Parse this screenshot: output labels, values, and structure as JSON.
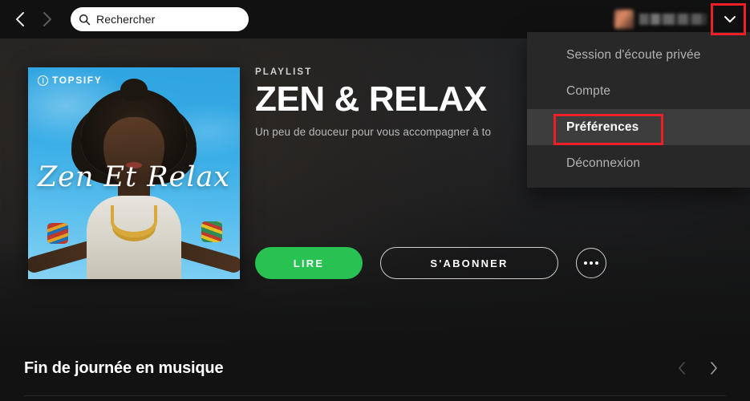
{
  "topbar": {
    "back_icon": "chevron-left-icon",
    "forward_icon": "chevron-right-icon",
    "search": {
      "icon": "search-icon",
      "value": "Rechercher",
      "placeholder": "Rechercher"
    },
    "user": {
      "avatar_alt": "user-avatar",
      "name_blurred": "",
      "chevron_icon": "chevron-down-icon"
    }
  },
  "dropdown": {
    "items": [
      {
        "label": "Session d'écoute privée",
        "highlighted": false
      },
      {
        "label": "Compte",
        "highlighted": false
      },
      {
        "label": "Préférences",
        "highlighted": true
      },
      {
        "label": "Déconnexion",
        "highlighted": false
      }
    ]
  },
  "playlist": {
    "kicker": "PLAYLIST",
    "title": "ZEN & RELAX",
    "description": "Un peu de douceur pour vous accompagner à to",
    "cover": {
      "brand_mark": "topsify-logo-icon",
      "brand_word": "TOPSIFY",
      "script_text": "Zen Et Relax"
    },
    "actions": {
      "play_label": "LIRE",
      "follow_label": "S'ABONNER",
      "more_icon": "more-options-icon"
    }
  },
  "section": {
    "title": "Fin de journée en musique",
    "prev_icon": "chevron-left-icon",
    "next_icon": "chevron-right-icon"
  },
  "annotations": {
    "color": "#ee1f26",
    "chevron_box": "highlight-profile-chevron",
    "preferences_box": "highlight-preferences-item"
  },
  "colors": {
    "accent_green": "#27c252",
    "page_bg": "#121212",
    "menu_bg": "#282828",
    "menu_highlight_bg": "#3d3d3d",
    "annotation_red": "#ee1f26"
  }
}
